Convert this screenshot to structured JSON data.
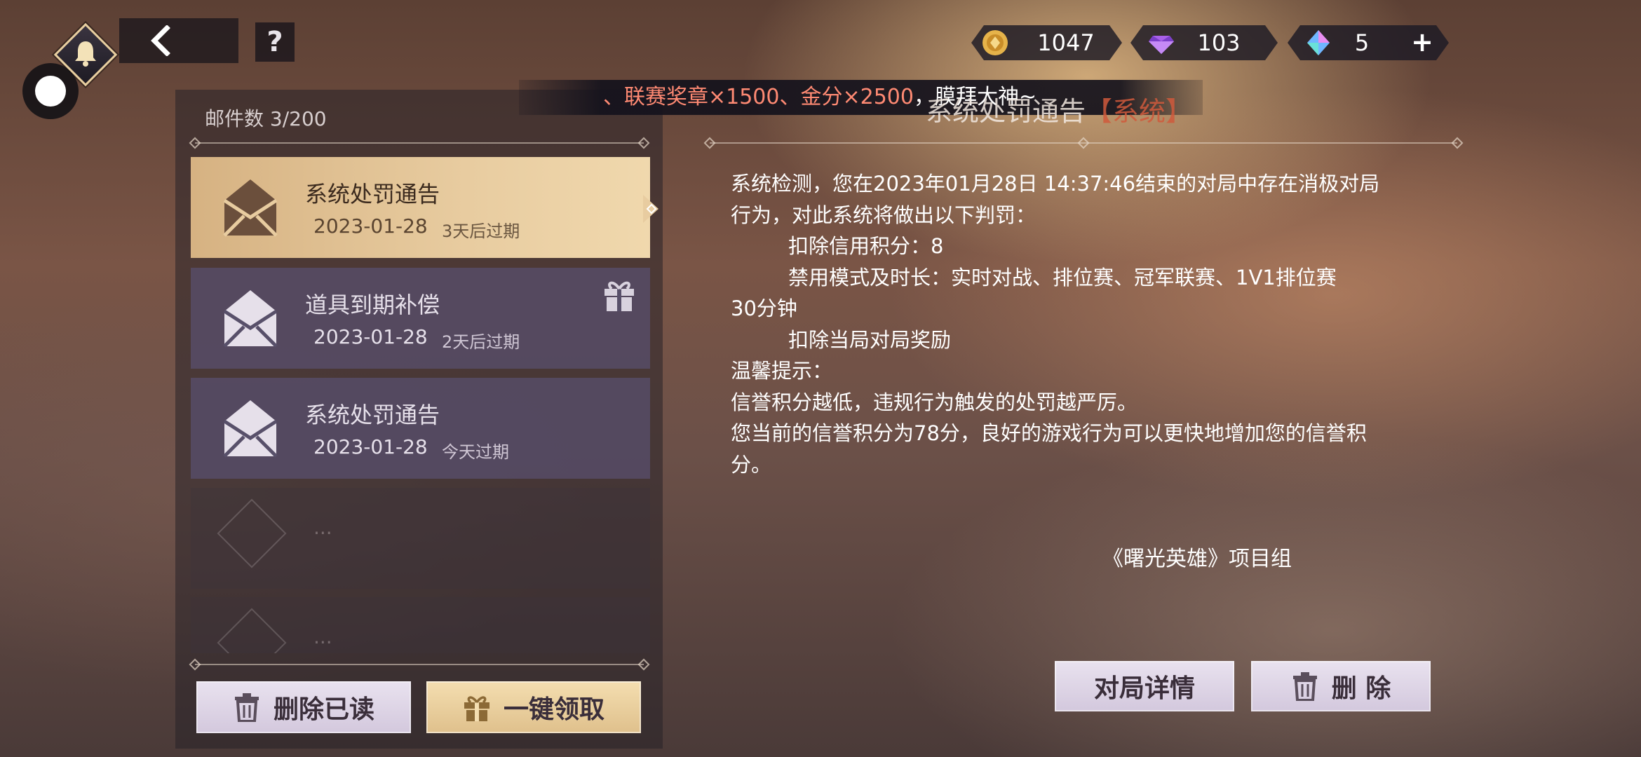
{
  "topbar": {
    "coin_value": "1047",
    "gem_value": "103",
    "diamond_value": "5",
    "plus_label": "+",
    "help_label": "?"
  },
  "marquee": {
    "highlight": "、联赛奖章×1500、金分×2500",
    "rest": "，膜拜大神~"
  },
  "mail_list": {
    "count_label": "邮件数  3/200",
    "items": [
      {
        "title": "系统处罚通告",
        "date": "2023-01-28",
        "expiry": "3天后过期"
      },
      {
        "title": "道具到期补偿",
        "date": "2023-01-28",
        "expiry": "2天后过期"
      },
      {
        "title": "系统处罚通告",
        "date": "2023-01-28",
        "expiry": "今天过期"
      }
    ],
    "empty_dots": "...",
    "delete_read_label": "删除已读",
    "claim_all_label": "一键领取"
  },
  "detail": {
    "title": "系统处罚通告",
    "tag": "【系统】",
    "lines": [
      "系统检测，您在2023年01月28日 14:37:46结束的对局中存在消极对局",
      "行为，对此系统将做出以下判罚：",
      "扣除信用积分：8",
      "禁用模式及时长：实时对战、排位赛、冠军联赛、1V1排位赛",
      "30分钟",
      "扣除当局对局奖励",
      "温馨提示：",
      "信誉积分越低，违规行为触发的处罚越严厉。",
      "您当前的信誉积分为78分，良好的游戏行为可以更快地增加您的信誉积",
      "分。"
    ],
    "signature": "《曙光英雄》项目组",
    "match_detail_label": "对局详情",
    "delete_label": "删 除"
  },
  "colors": {
    "active_item": "#e8cca0",
    "normal_item": "#58506a",
    "tag_red": "#d05a3c",
    "marquee_highlight": "#ff8a73"
  }
}
